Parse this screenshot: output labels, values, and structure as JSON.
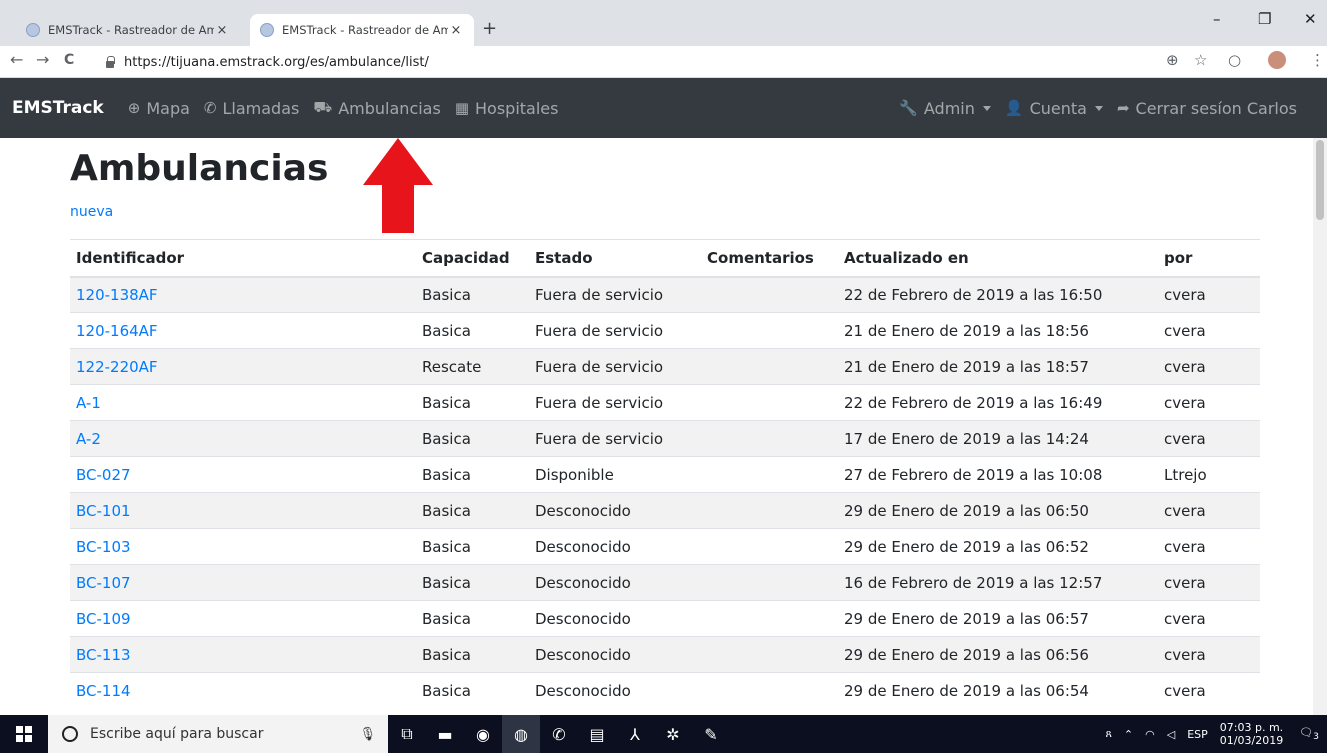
{
  "browser": {
    "tabs": [
      {
        "title": "EMSTrack - Rastreador de Ambul"
      },
      {
        "title": "EMSTrack - Rastreador de Ambul"
      }
    ],
    "close_glyph": "×",
    "newtab_glyph": "+",
    "url": "https://tijuana.emstrack.org/es/ambulance/list/",
    "nav": {
      "back": "←",
      "forward": "→",
      "reload": "C"
    },
    "window": {
      "minimize": "–",
      "maximize": "❐",
      "close": "✕"
    },
    "toolbar_icons": {
      "zoom": "⊕",
      "star": "☆",
      "ext": "○",
      "menu": "⋮"
    }
  },
  "navbar": {
    "brand": "EMSTrack",
    "links": [
      {
        "icon": "globe-icon",
        "glyph": "⊕",
        "label": "Mapa"
      },
      {
        "icon": "phone-icon",
        "glyph": "✆",
        "label": "Llamadas"
      },
      {
        "icon": "ambulance-icon",
        "glyph": "⛟",
        "label": "Ambulancias"
      },
      {
        "icon": "hospital-icon",
        "glyph": "▦",
        "label": "Hospitales"
      }
    ],
    "right": {
      "admin": {
        "glyph": "🔧",
        "label": "Admin"
      },
      "account": {
        "glyph": "👤",
        "label": "Cuenta"
      },
      "logout": {
        "glyph": "➦",
        "label": "Cerrar sesíon Carlos"
      }
    }
  },
  "page": {
    "title": "Ambulancias",
    "new_link": "nueva"
  },
  "annotation": {
    "color": "#e8141c"
  },
  "table": {
    "columns": [
      "Identificador",
      "Capacidad",
      "Estado",
      "Comentarios",
      "Actualizado en",
      "por"
    ],
    "rows": [
      [
        "120-138AF",
        "Basica",
        "Fuera de servicio",
        "",
        "22 de Febrero de 2019 a las 16:50",
        "cvera"
      ],
      [
        "120-164AF",
        "Basica",
        "Fuera de servicio",
        "",
        "21 de Enero de 2019 a las 18:56",
        "cvera"
      ],
      [
        "122-220AF",
        "Rescate",
        "Fuera de servicio",
        "",
        "21 de Enero de 2019 a las 18:57",
        "cvera"
      ],
      [
        "A-1",
        "Basica",
        "Fuera de servicio",
        "",
        "22 de Febrero de 2019 a las 16:49",
        "cvera"
      ],
      [
        "A-2",
        "Basica",
        "Fuera de servicio",
        "",
        "17 de Enero de 2019 a las 14:24",
        "cvera"
      ],
      [
        "BC-027",
        "Basica",
        "Disponible",
        "",
        "27 de Febrero de 2019 a las 10:08",
        "Ltrejo"
      ],
      [
        "BC-101",
        "Basica",
        "Desconocido",
        "",
        "29 de Enero de 2019 a las 06:50",
        "cvera"
      ],
      [
        "BC-103",
        "Basica",
        "Desconocido",
        "",
        "29 de Enero de 2019 a las 06:52",
        "cvera"
      ],
      [
        "BC-107",
        "Basica",
        "Desconocido",
        "",
        "16 de Febrero de 2019 a las 12:57",
        "cvera"
      ],
      [
        "BC-109",
        "Basica",
        "Desconocido",
        "",
        "29 de Enero de 2019 a las 06:57",
        "cvera"
      ],
      [
        "BC-113",
        "Basica",
        "Desconocido",
        "",
        "29 de Enero de 2019 a las 06:56",
        "cvera"
      ],
      [
        "BC-114",
        "Basica",
        "Desconocido",
        "",
        "29 de Enero de 2019 a las 06:54",
        "cvera"
      ]
    ]
  },
  "taskbar": {
    "search_placeholder": "Escribe aquí para buscar",
    "apps": [
      {
        "icon": "task-view-icon",
        "glyph": "⧉"
      },
      {
        "icon": "file-explorer-icon",
        "glyph": "▬"
      },
      {
        "icon": "media-icon",
        "glyph": "◉"
      },
      {
        "icon": "chrome-icon",
        "glyph": "◍"
      },
      {
        "icon": "whatsapp-icon",
        "glyph": "✆"
      },
      {
        "icon": "document-icon",
        "glyph": "▤"
      },
      {
        "icon": "pdf-icon",
        "glyph": "⅄"
      },
      {
        "icon": "settings-icon",
        "glyph": "✲"
      },
      {
        "icon": "paint-icon",
        "glyph": "✎"
      }
    ],
    "language": "ESP",
    "time": "07:03 p. m.",
    "date": "01/03/2019",
    "notification_count": "3"
  }
}
